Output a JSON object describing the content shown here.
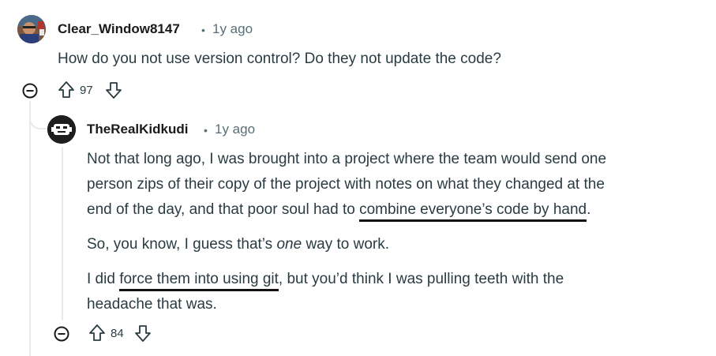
{
  "comment1": {
    "username": "Clear_Window8147",
    "separator": "•",
    "timestamp": "1y ago",
    "text": "How do you not use version control? Do they not update the code?",
    "votes": "97",
    "collapse_icon": "minus-circle-icon",
    "upvote_icon": "arrow-up-outline-icon",
    "downvote_icon": "arrow-down-outline-icon"
  },
  "comment2": {
    "username": "TheRealKidkudi",
    "separator": "•",
    "timestamp": "1y ago",
    "paragraph1": {
      "line1": "Not that long ago, I was brought into a project where the team would send one",
      "line2": "person zips of their copy of the project with notes on what they changed at the",
      "line3_before": "end of the day, and that poor soul had to ",
      "line3_underlined": "combine everyone’s code by hand",
      "line3_after": "."
    },
    "paragraph2": {
      "before": "So, you know, I guess that’s ",
      "emphasis": "one",
      "after": " way to work."
    },
    "paragraph3": {
      "line1_before": "I did ",
      "line1_underlined": "force them into using git",
      "line1_after": ", but you’d think I was pulling teeth with the",
      "line2": "headache that was."
    },
    "votes": "84",
    "collapse_icon": "minus-circle-icon",
    "upvote_icon": "arrow-up-outline-icon",
    "downvote_icon": "arrow-down-outline-icon"
  },
  "colors": {
    "text": "#2a3c42",
    "meta": "#576f76",
    "thread_line": "#e5ebee",
    "annotation": "#111111"
  }
}
